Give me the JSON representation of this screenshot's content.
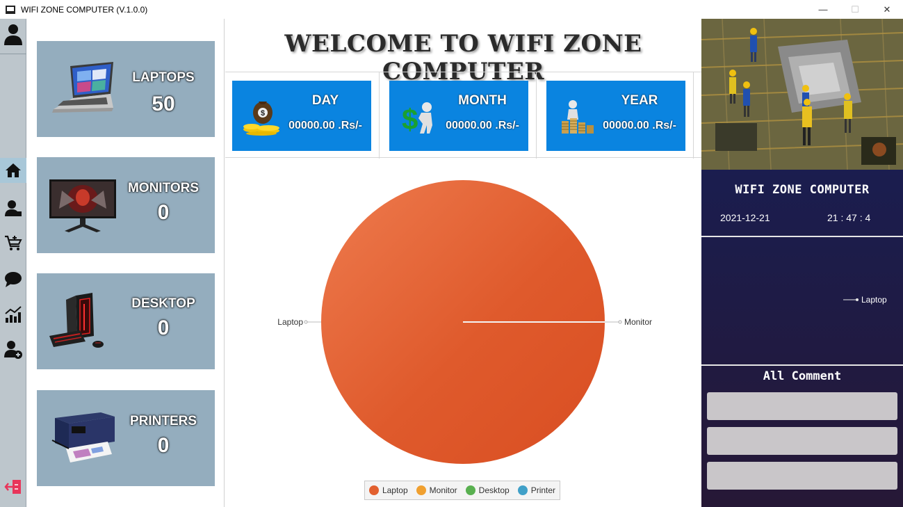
{
  "window": {
    "title": "WIFI ZONE COMPUTER (V.1.0.0)",
    "minimize_glyph": "—",
    "maximize_glyph": "☐",
    "close_glyph": "✕"
  },
  "sidebar": {
    "items": [
      {
        "name": "user-icon"
      },
      {
        "name": "home-icon",
        "active": true
      },
      {
        "name": "manage-users-icon"
      },
      {
        "name": "add-cart-icon"
      },
      {
        "name": "chat-icon"
      },
      {
        "name": "analytics-icon"
      },
      {
        "name": "add-user-icon"
      },
      {
        "name": "logout-icon"
      }
    ]
  },
  "cards": [
    {
      "label": "LAPTOPS",
      "value": "50",
      "icon": "laptop-image"
    },
    {
      "label": "MONITORS",
      "value": "0",
      "icon": "monitor-image"
    },
    {
      "label": "DESKTOP",
      "value": "0",
      "icon": "desktop-image"
    },
    {
      "label": "PRINTERS",
      "value": "0",
      "icon": "printer-image"
    }
  ],
  "header": {
    "title": "WELCOME TO WIFI ZONE COMPUTER"
  },
  "stats": [
    {
      "label": "DAY",
      "value": "00000.00 .Rs/-",
      "icon": "money-bag-icon"
    },
    {
      "label": "MONTH",
      "value": "00000.00 .Rs/-",
      "icon": "dollar-figure-icon"
    },
    {
      "label": "YEAR",
      "value": "00000.00 .Rs/-",
      "icon": "coins-figure-icon"
    }
  ],
  "chart_data": {
    "type": "pie",
    "categories": [
      "Laptop",
      "Monitor",
      "Desktop",
      "Printer"
    ],
    "values": [
      50,
      0,
      0,
      0
    ],
    "colors": [
      "#e2602f",
      "#f0a030",
      "#59b050",
      "#40a0c8"
    ],
    "slice_labels": [
      "Laptop",
      "Monitor"
    ],
    "legend": "bottom"
  },
  "legend": {
    "items": [
      {
        "label": "Laptop",
        "color": "#e2602f"
      },
      {
        "label": "Monitor",
        "color": "#f0a030"
      },
      {
        "label": "Desktop",
        "color": "#59b050"
      },
      {
        "label": "Printer",
        "color": "#40a0c8"
      }
    ]
  },
  "right": {
    "brand": "WIFI ZONE COMPUTER",
    "date": "2021-12-21",
    "time": "21 : 47 : 4",
    "mini_chart_label": "Laptop",
    "comment_title": "All Comment",
    "comments": [
      "",
      "",
      ""
    ]
  },
  "colors": {
    "card_bg": "#94adbe",
    "stat_bg": "#0a84e0",
    "panel_dark": "#1c1c4a",
    "accent_logout": "#e8355a"
  }
}
